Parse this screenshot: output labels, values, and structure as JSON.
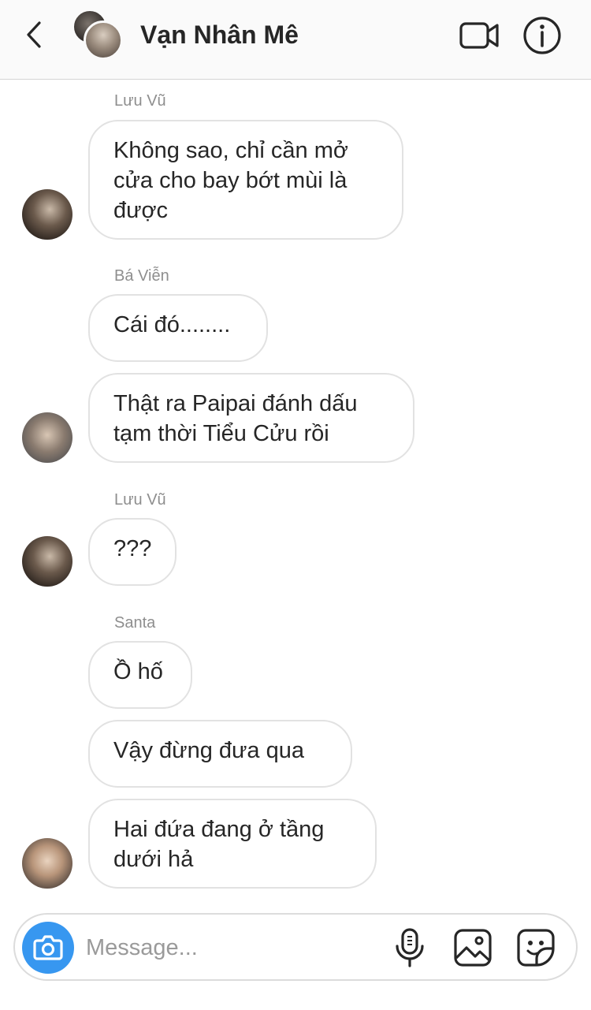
{
  "header": {
    "title": "Vạn Nhân Mê",
    "back_icon": "chevron-left-icon",
    "video_icon": "video-camera-icon",
    "info_icon": "info-icon"
  },
  "messages": [
    {
      "sender": "Lưu Vũ",
      "text": "Không sao, chỉ cần mở\ncửa cho bay bớt mùi là\nđược"
    },
    {
      "sender": "Bá Viễn",
      "text": "Cái đó........"
    },
    {
      "text": "Thật ra Paipai đánh dấu\ntạm thời Tiểu Cửu rồi"
    },
    {
      "sender": "Lưu Vũ",
      "text": "???"
    },
    {
      "sender": "Santa",
      "text": "Ồ hố"
    },
    {
      "text": "Vậy đừng đưa qua"
    },
    {
      "text": "Hai đứa đang ở tầng\ndưới hả"
    }
  ],
  "composer": {
    "placeholder": "Message...",
    "camera_icon": "camera-icon",
    "mic_icon": "microphone-icon",
    "gallery_icon": "image-icon",
    "sticker_icon": "sticker-icon",
    "accent_color": "#3797f0"
  }
}
